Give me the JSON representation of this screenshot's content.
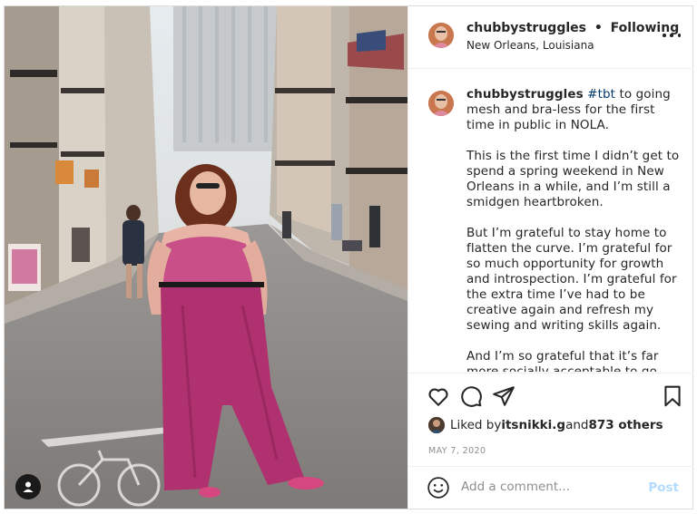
{
  "post": {
    "username": "chubbystruggles",
    "separator": "•",
    "follow_status": "Following",
    "location": "New Orleans, Louisiana",
    "caption_username": "chubbystruggles",
    "caption_hashtag": "#tbt",
    "caption_p1_rest": " to going mesh and bra-less for the first time in public in NOLA.",
    "caption_p2": "This is the first time I didn’t get to spend a spring weekend in New Orleans in a while, and I’m still a smidgen heartbroken.",
    "caption_p3": "But I’m grateful to stay home to flatten the curve. I’m grateful for so much opportunity for growth and introspection. I’m grateful for the extra time I’ve had to be creative again and refresh my sewing and writing skills again.",
    "caption_p4": "And I’m so grateful that it’s far more socially acceptable to go"
  },
  "likes": {
    "prefix": "Liked by ",
    "user": "itsnikki.g",
    "joiner": " and ",
    "others": "873 others"
  },
  "date": "MAY 7, 2020",
  "comment": {
    "placeholder": "Add a comment...",
    "post_label": "Post"
  },
  "icons": {
    "like": "heart-icon",
    "comment": "comment-bubble-icon",
    "share": "paper-plane-icon",
    "save": "bookmark-icon",
    "emoji": "smiley-icon",
    "more": "ellipsis-icon",
    "tag": "user-tag-icon"
  },
  "colors": {
    "text": "#262626",
    "muted": "#8e8e8e",
    "link": "#00376b",
    "post_disabled": "#b3dbff"
  }
}
